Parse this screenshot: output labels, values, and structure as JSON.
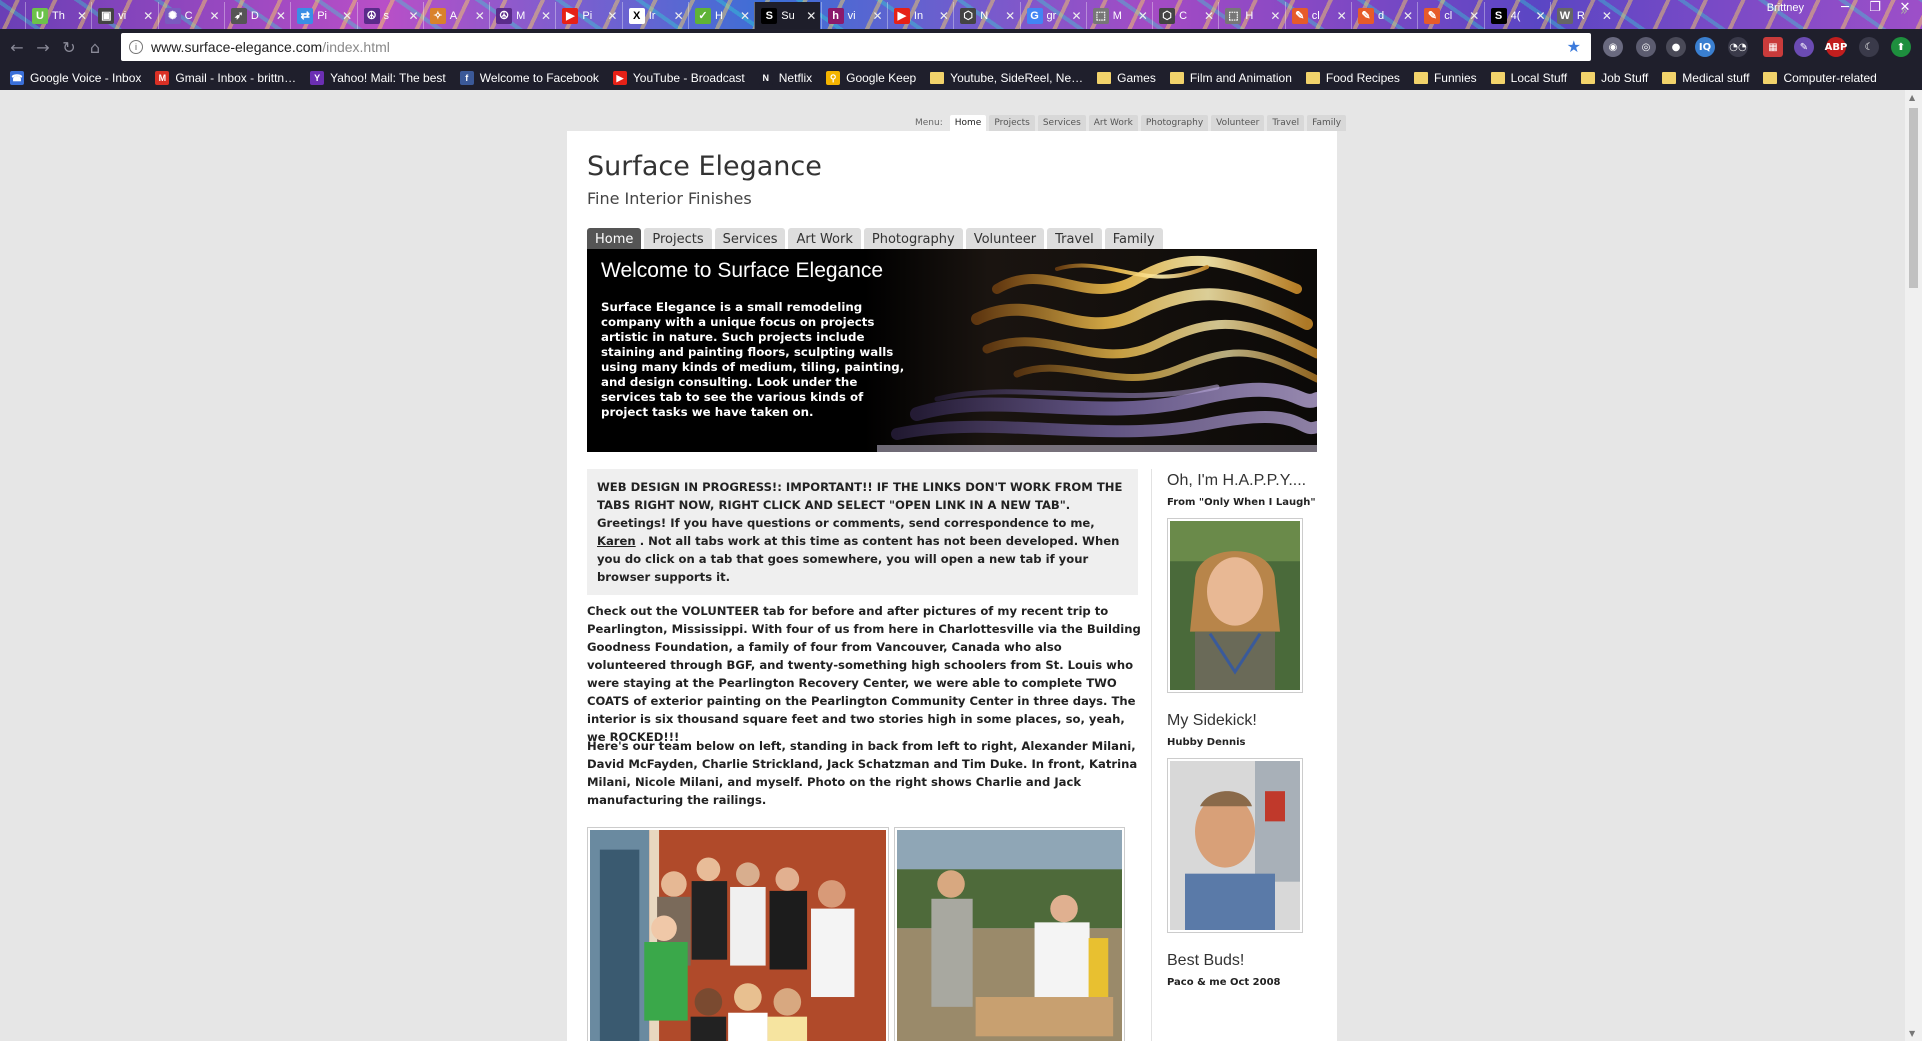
{
  "browser": {
    "tabs": [
      {
        "letter": "U",
        "title": "Th",
        "color": "#6cc24a"
      },
      {
        "letter": "▣",
        "title": "vi",
        "color": "#444444"
      },
      {
        "letter": "✺",
        "title": "C",
        "color": "#7a5bbf"
      },
      {
        "letter": "➶",
        "title": "D",
        "color": "#555555"
      },
      {
        "letter": "⇄",
        "title": "Pi",
        "color": "#3a8ee6"
      },
      {
        "letter": "☮",
        "title": "s",
        "color": "#5a2b8a"
      },
      {
        "letter": "✧",
        "title": "A",
        "color": "#d9822b"
      },
      {
        "letter": "☮",
        "title": "M",
        "color": "#5a2b8a"
      },
      {
        "letter": "▶",
        "title": "Pi",
        "color": "#e62117"
      },
      {
        "letter": "X",
        "title": "Ir",
        "color": "#ffffff"
      },
      {
        "letter": "✓",
        "title": "H",
        "color": "#5fb336"
      },
      {
        "letter": "S",
        "title": "Su",
        "color": "#000000"
      },
      {
        "letter": "h",
        "title": "vi",
        "color": "#8b1a6b"
      },
      {
        "letter": "▶",
        "title": "In",
        "color": "#e62117"
      },
      {
        "letter": "⬡",
        "title": "N",
        "color": "#444444"
      },
      {
        "letter": "G",
        "title": "gr",
        "color": "#4285f4"
      },
      {
        "letter": "⬚",
        "title": "M",
        "color": "#777777"
      },
      {
        "letter": "⬡",
        "title": "C",
        "color": "#444444"
      },
      {
        "letter": "⬚",
        "title": "H",
        "color": "#777777"
      },
      {
        "letter": "✎",
        "title": "cl",
        "color": "#e65b2a"
      },
      {
        "letter": "✎",
        "title": "d",
        "color": "#e65b2a"
      },
      {
        "letter": "✎",
        "title": "cl",
        "color": "#e65b2a"
      },
      {
        "letter": "S",
        "title": "4(",
        "color": "#000000"
      },
      {
        "letter": "W",
        "title": "R",
        "color": "#666666"
      }
    ],
    "active_tab_index": 11,
    "profile_name": "Brittney",
    "url_host": "www.surface-elegance.com",
    "url_path": "/index.html",
    "bookmarks": [
      {
        "label": "Google Voice - Inbox",
        "kind": "icon",
        "icon": "☎",
        "color": "#3a6fd8"
      },
      {
        "label": "Gmail - Inbox - brittn…",
        "kind": "icon",
        "icon": "M",
        "color": "#d93025"
      },
      {
        "label": "Yahoo! Mail: The best",
        "kind": "icon",
        "icon": "Y",
        "color": "#6b2fb3"
      },
      {
        "label": "Welcome to Facebook",
        "kind": "icon",
        "icon": "f",
        "color": "#3b5998"
      },
      {
        "label": "YouTube - Broadcast",
        "kind": "icon",
        "icon": "▶",
        "color": "#e62117"
      },
      {
        "label": "Netflix",
        "kind": "icon",
        "icon": "N",
        "color": "#1f1f2c"
      },
      {
        "label": "Google Keep",
        "kind": "icon",
        "icon": "⚲",
        "color": "#f4b400"
      },
      {
        "label": "Youtube, SideReel, Ne…",
        "kind": "folder"
      },
      {
        "label": "Games",
        "kind": "folder"
      },
      {
        "label": "Film and Animation",
        "kind": "folder"
      },
      {
        "label": "Food Recipes",
        "kind": "folder"
      },
      {
        "label": "Funnies",
        "kind": "folder"
      },
      {
        "label": "Local Stuff",
        "kind": "folder"
      },
      {
        "label": "Job Stuff",
        "kind": "folder"
      },
      {
        "label": "Medical stuff",
        "kind": "folder"
      },
      {
        "label": "Computer-related",
        "kind": "folder"
      }
    ],
    "bookmarks_more": "»"
  },
  "site": {
    "mini_menu_label": "Menu:",
    "mini_menu": [
      "Home",
      "Projects",
      "Services",
      "Art Work",
      "Photography",
      "Volunteer",
      "Travel",
      "Family"
    ],
    "title": "Surface Elegance",
    "tagline": "Fine Interior Finishes",
    "tabs": [
      "Home",
      "Projects",
      "Services",
      "Art Work",
      "Photography",
      "Volunteer",
      "Travel",
      "Family"
    ],
    "active_tab": 0,
    "banner_heading": "Welcome to Surface Elegance",
    "banner_text": "Surface Elegance is a small remodeling company with a unique focus on projects artistic in nature. Such projects include staining and painting floors, sculpting walls using many kinds of medium, tiling, painting, and design consulting. Look under the services tab to see the various kinds of project tasks we have taken on.",
    "notice_before": "WEB DESIGN IN PROGRESS!: IMPORTANT!! IF THE LINKS DON'T WORK FROM THE TABS RIGHT NOW, RIGHT CLICK AND SELECT \"OPEN LINK IN A NEW TAB\". Greetings! If you have questions or comments, send correspondence to me, ",
    "notice_link": "Karen",
    "notice_after": " . Not all tabs work at this time as content has not been developed. When you do click on a tab that goes somewhere, you will open a new tab if your browser supports it.",
    "para1": "Check out the VOLUNTEER tab for before and after pictures of my recent trip to Pearlington, Mississippi. With four of us from here in Charlottesville via the Building Goodness Foundation, a family of four from Vancouver, Canada who also volunteered through BGF, and twenty-something high schoolers from St. Louis who were staying at the Pearlington Recovery Center, we were able to complete TWO COATS of exterior painting on the Pearlington Community Center in three days. The interior is six thousand square feet and two stories high in some places, so, yeah, we ROCKED!!!",
    "para2": "Here's our team below on left, standing in back from left to right, Alexander Milani, David McFayden, Charlie Strickland, Jack Schatzman and Tim Duke. In front, Katrina Milani, Nicole Milani, and myself. Photo on the right shows Charlie and Jack manufacturing the railings.",
    "sidebar": [
      {
        "heading": "Oh, I'm H.A.P.P.Y....",
        "caption": "From \"Only When I Laugh\""
      },
      {
        "heading": "My Sidekick!",
        "caption": "Hubby Dennis"
      },
      {
        "heading": "Best Buds!",
        "caption": "Paco & me Oct 2008"
      }
    ]
  }
}
